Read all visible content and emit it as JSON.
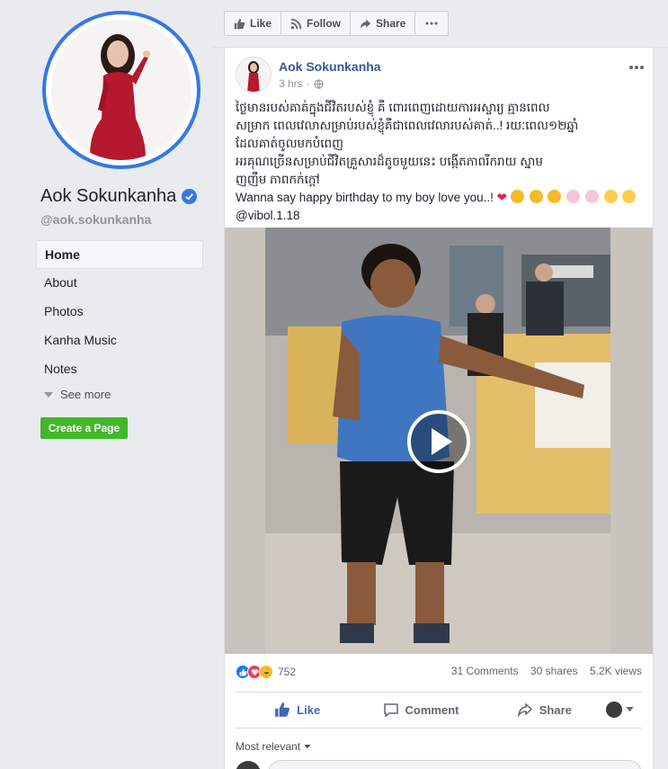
{
  "page": {
    "name": "Aok Sokunkanha",
    "handle": "@aok.sokunkanha"
  },
  "nav": {
    "items": [
      "Home",
      "About",
      "Photos",
      "Kanha Music",
      "Notes"
    ],
    "see_more": "See more",
    "create_page": "Create a Page"
  },
  "action_bar": {
    "like": "Like",
    "follow": "Follow",
    "share": "Share"
  },
  "post": {
    "author": "Aok Sokunkanha",
    "time": "3 hrs",
    "text_lines": [
      "ថ្ងៃមានរបស់គាត់ក្នុងជីវិតរបស់ខ្ញុំ គឺ ពោរពេញដោយការអស្ចារ្យ គ្មានពេល",
      "សម្រាក ពេលវេលាសម្រាប់របស់ខ្ញុំគឺជាពេលវេលារបស់គាត់..! រយៈពេល១២ឆ្នាំ",
      "ដែលគាត់ចូលមកបំពេញ",
      "អរគុណច្រើនសម្រាប់ជីវិតគ្រួសារដ៏តូចមួយនេះ បង្កើតភាពរីករាយ ស្នាម",
      "ញញឹម ភាពកក់ក្តៅ",
      "Wanna say happy birthday to my boy love you..!",
      "@vibol.1.18"
    ],
    "reaction_count": "752",
    "comments": "31 Comments",
    "shares": "30 shares",
    "views": "5.2K views",
    "actions": {
      "like": "Like",
      "comment": "Comment",
      "share": "Share"
    },
    "sort_label": "Most relevant"
  },
  "colors": {
    "brand_blue": "#3578e5",
    "link_blue": "#385898",
    "green": "#42b72a",
    "background": "#e9ebee"
  }
}
